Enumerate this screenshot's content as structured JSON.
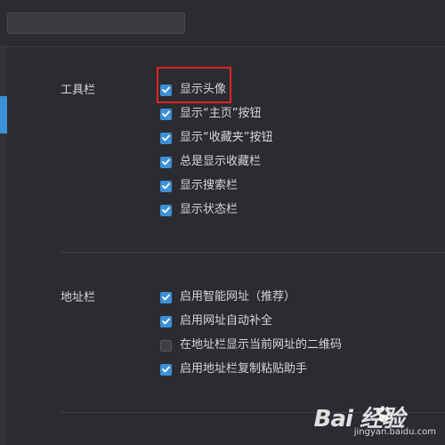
{
  "toolbar_section": {
    "label": "工具栏",
    "options": [
      {
        "label": "显示头像",
        "checked": true
      },
      {
        "label": "显示“主页”按钮",
        "checked": true
      },
      {
        "label": "显示“收藏夹”按钮",
        "checked": true
      },
      {
        "label": "总是显示收藏栏",
        "checked": true
      },
      {
        "label": "显示搜索栏",
        "checked": true
      },
      {
        "label": "显示状态栏",
        "checked": true
      }
    ]
  },
  "address_section": {
    "label": "地址栏",
    "options": [
      {
        "label": "启用智能网址（推荐）",
        "checked": true
      },
      {
        "label": "启用网址自动补全",
        "checked": true
      },
      {
        "label": "在地址栏显示当前网址的二维码",
        "checked": false
      },
      {
        "label": "启用地址栏复制粘贴助手",
        "checked": true
      }
    ]
  },
  "watermark": {
    "logo_text": "Bai 经验",
    "site": "jingyan.baidu.com"
  },
  "colors": {
    "background": "#2b2c31",
    "accent": "#3d8fd6",
    "highlight": "#e0241f"
  },
  "icons": {
    "checked": "checkmark-icon"
  }
}
